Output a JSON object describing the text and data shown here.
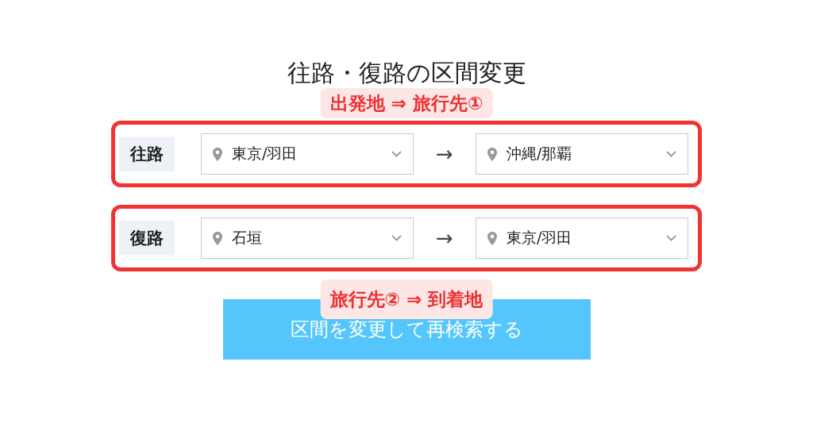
{
  "title": "往路・復路の区間変更",
  "annotations": [
    {
      "text": "出発地 ⇒ 旅行先①"
    },
    {
      "text": "旅行先② ⇒ 到着地"
    }
  ],
  "routes": [
    {
      "label": "往路",
      "from": "東京/羽田",
      "arrow": "→",
      "to": "沖縄/那覇"
    },
    {
      "label": "復路",
      "from": "石垣",
      "arrow": "→",
      "to": "東京/羽田"
    }
  ],
  "button": "区間を変更して再検索する"
}
